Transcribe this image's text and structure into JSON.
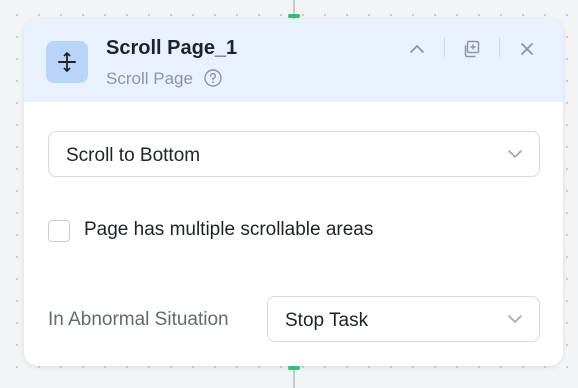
{
  "node": {
    "title": "Scroll Page_1",
    "subtitle": "Scroll Page",
    "icon": "scroll-vertical-icon",
    "header_bg": "#e8f1fd",
    "icon_bg": "#b9d4f9"
  },
  "header_actions": {
    "collapse_icon": "chevron-up-icon",
    "copy_icon": "copy-icon",
    "close_icon": "close-icon"
  },
  "scroll_mode": {
    "value": "Scroll to Bottom"
  },
  "multiple_areas": {
    "label": "Page has multiple scrollable areas",
    "checked": false
  },
  "abnormal": {
    "label": "In Abnormal Situation",
    "value": "Stop Task"
  },
  "connector_color": "#2fc26e"
}
